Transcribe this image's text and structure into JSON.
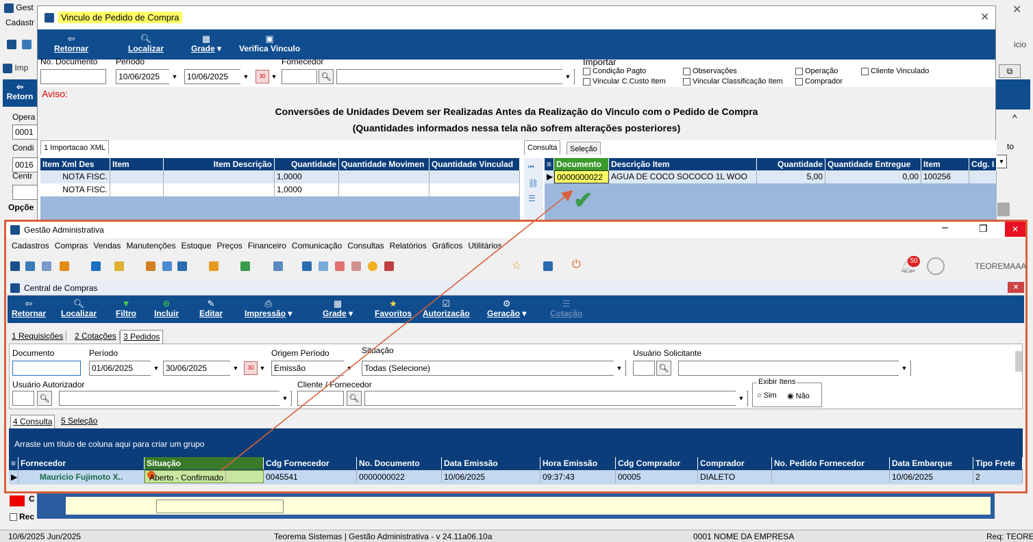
{
  "bg": {
    "title": "Gest",
    "menu_fragment": "Cadastr",
    "right_fragment": "icio",
    "inner_title": "Imp",
    "inner_btn": "Retorn",
    "opera": "Opera",
    "opera_val": "0001",
    "cond": "Condi",
    "cond_val": "0016",
    "centr": "Centr",
    "opcoe": "Opçõe",
    "to_fragment": "to",
    "status_left": "10/6/2025 Jun/2025",
    "status_center": "Teorema Sistemas | Gestão Administrativa - v 24.11a06.10a",
    "status_empresa": "0001 NOME DA EMPRESA",
    "status_right": "Req: TEORE",
    "rec_fragment": "Rec",
    "c_fragment": "C"
  },
  "dialog": {
    "title": "Vinculo de Pedido de Compra",
    "toolbar": {
      "retornar": "Retornar",
      "localizar": "Localizar",
      "grade": "Grade",
      "verifica": "Verifica Vinculo"
    },
    "labels": {
      "no_documento": "No. Documento",
      "periodo": "Período",
      "fornecedor": "Fornecedor",
      "importar": "Importar"
    },
    "values": {
      "date_from": "10/06/2025",
      "date_to": "10/06/2025"
    },
    "checks": [
      "Condição Pagto",
      "Vincular C.Custo Item",
      "Observações",
      "Vincular Classificação Item",
      "Operação",
      "Comprador",
      "Cliente Vinculado"
    ],
    "aviso_label": "Aviso:",
    "aviso_line1": "Conversões de Unidades Devem ser Realizadas Antes da Realização do Vinculo com o Pedido de Compra",
    "aviso_line2": "(Quantidades informados nessa tela não sofrem alterações posteriores)",
    "left_tab": "1 Importacao XML",
    "left_cols": [
      "Item Xml Des",
      "Item",
      "Item Descrição",
      "Quantidade",
      "Quantidade Movimen",
      "Quantidade Vinculad"
    ],
    "left_rows": [
      [
        "NOTA FISC.",
        "",
        "",
        "1,0000",
        "",
        ""
      ],
      [
        "NOTA FISC.",
        "",
        "",
        "1,0000",
        "",
        ""
      ]
    ],
    "right_tabs": [
      "Consulta",
      "Seleção"
    ],
    "right_cols": [
      "Documento",
      "Descrição Item",
      "Quantidade",
      "Quantidade Entregue",
      "Item",
      "Cdg. I"
    ],
    "right_rows": [
      [
        "0000000022",
        "AGUA DE COCO SOCOCO 1L WOO",
        "5,00",
        "0,00",
        "100256",
        ""
      ]
    ]
  },
  "front": {
    "title": "Gestão Administrativa",
    "menu": [
      "Cadastros",
      "Compras",
      "Vendas",
      "Manutenções",
      "Estoque",
      "Preços",
      "Financeiro",
      "Comunicação",
      "Consultas",
      "Relatórios",
      "Gráficos",
      "Utilitários"
    ],
    "notif_count": "50",
    "user": "TEOREMAAA",
    "child_title": "Central de Compras",
    "toolbar": [
      "Retornar",
      "Localizar",
      "Filtro",
      "Incluir",
      "Editar",
      "Impressão",
      "Grade",
      "Favoritos",
      "Autorização",
      "Geração",
      "Cotação"
    ],
    "tabs": [
      "1 Requisições",
      "2 Cotações",
      "3 Pedidos"
    ],
    "labels": {
      "documento": "Documento",
      "periodo": "Período",
      "origem": "Origem Período",
      "situacao": "Situação",
      "solicitante": "Usuário Solicitante",
      "autorizador": "Usuário Autorizador",
      "cliente": "Cliente / Fornecedor",
      "exibir": "Exibir Itens",
      "sim": "Sim",
      "nao": "Não"
    },
    "values": {
      "date_from": "01/06/2025",
      "date_to": "30/06/2025",
      "origem": "Emissão",
      "situacao": "Todas (Selecione)"
    },
    "bottom_tabs": [
      "4 Consulta",
      "5 Seleção"
    ],
    "group_hint": "Arraste um título de coluna aqui para criar um grupo",
    "cols": [
      "Fornecedor",
      "Situação",
      "Cdg Fornecedor",
      "No. Documento",
      "Data Emissão",
      "Hora Emissão",
      "Cdg Comprador",
      "Comprador",
      "No. Pedido Fornecedor",
      "Data Embarque",
      "Tipo Frete"
    ],
    "row": [
      "Mauricio Fujimoto X..",
      "Aberto - Confirmado",
      "0045541",
      "0000000022",
      "10/06/2025",
      "09:37:43",
      "00005",
      "DIALETO",
      "",
      "10/06/2025",
      "2"
    ]
  },
  "colors": {
    "accent_red": "#d9603a",
    "header_blue": "#0b3d7a",
    "toolbar_blue": "#0f4d8f",
    "highlight_yellow": "#ffff66",
    "sel_green": "#c8e6a0"
  }
}
